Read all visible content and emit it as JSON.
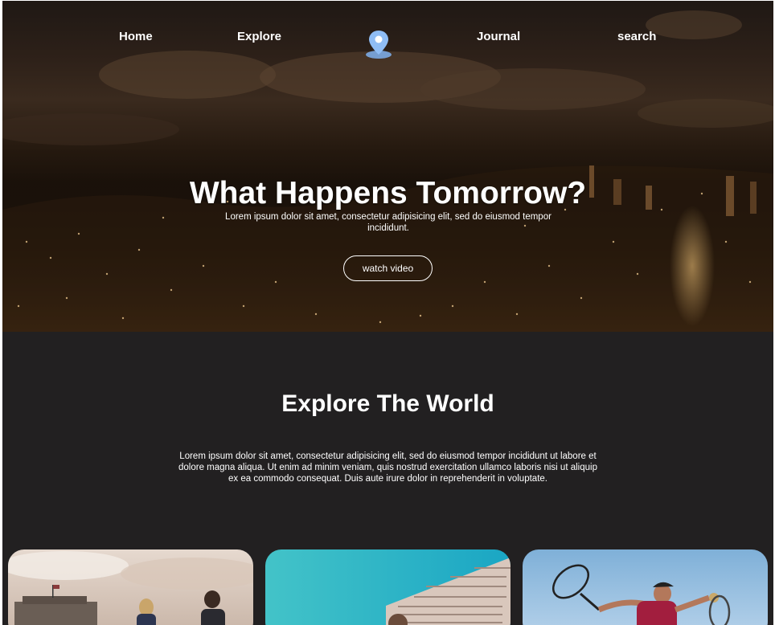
{
  "nav": {
    "links": [
      "Home",
      "Explore",
      "Journal",
      "search"
    ],
    "logo_icon": "map-pin-icon",
    "logo_color": "#7fb2f0"
  },
  "hero": {
    "title": "What Happens Tomorrow?",
    "subtitle": "Lorem ipsum dolor sit amet, consectetur adipisicing elit, sed do eiusmod tempor incididunt.",
    "button_label": "watch video"
  },
  "explore": {
    "title": "Explore The World",
    "text": "Lorem ipsum dolor sit amet, consectetur adipisicing elit, sed do eiusmod tempor incididunt ut labore et dolore magna aliqua. Ut enim ad minim veniam, quis nostrud exercitation ullamco laboris nisi ut aliquip ex ea commodo consequat. Duis aute irure dolor in reprehenderit in voluptate."
  },
  "colors": {
    "section_bg": "#222021",
    "text": "#ffffff"
  }
}
